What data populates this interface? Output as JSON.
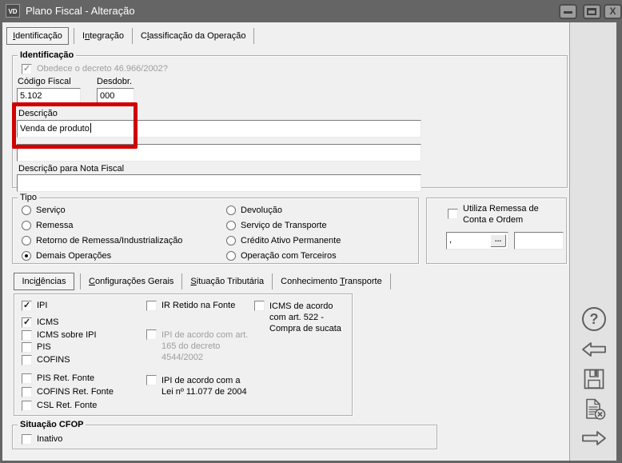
{
  "colors": {
    "titlebar": "#656565",
    "client_bg": "#f0f0f0",
    "side_panel_bg": "#e2e2e2",
    "annotation": "#d10000"
  },
  "window": {
    "title": "Plano Fiscal - Alteração",
    "icon_text": "VD",
    "close_glyph": "X"
  },
  "main_tabs": [
    {
      "label": "Identificação",
      "label_html": "<u>I</u>dentificação",
      "active": true
    },
    {
      "label": "Integração",
      "label_html": "I<u>n</u>tegração",
      "active": false
    },
    {
      "label": "Classificação da Operação",
      "label_html": "C<u>l</u>assificação da Operação",
      "active": false
    }
  ],
  "identificacao": {
    "group_label": "Identificação",
    "obedece_checkbox": {
      "label": "Obedece o decreto 46.966/2002?",
      "checked": true,
      "disabled": true
    },
    "codigo_fiscal": {
      "label": "Código Fiscal",
      "value": "5.102"
    },
    "desdobr": {
      "label": "Desdobr.",
      "value": "000"
    },
    "descricao": {
      "label": "Descrição",
      "value": "Venda de produto"
    },
    "descricao2": {
      "value": ""
    },
    "descricao_nf": {
      "label": "Descrição para Nota Fiscal",
      "value": ""
    }
  },
  "annotation": {
    "type": "highlight-box",
    "color": "#d10000",
    "around": "descricao-label-and-field"
  },
  "tipo": {
    "group_label": "Tipo",
    "options_left": [
      {
        "label": "Serviço",
        "selected": false
      },
      {
        "label": "Remessa",
        "selected": false
      },
      {
        "label": "Retorno de Remessa/Industrialização",
        "selected": false
      },
      {
        "label": "Demais Operações",
        "selected": true
      }
    ],
    "options_right": [
      {
        "label": "Devolução",
        "selected": false
      },
      {
        "label": "Serviço de Transporte",
        "selected": false
      },
      {
        "label": "Crédito Ativo Permanente",
        "selected": false
      },
      {
        "label": "Operação com Terceiros",
        "selected": false
      }
    ]
  },
  "remessa_conta_ordem": {
    "checkbox": {
      "label": "Utiliza Remessa de Conta e Ordem",
      "checked": false
    },
    "code_field": {
      "value": ",",
      "browse_button": "..."
    },
    "extra_field": {
      "value": ""
    }
  },
  "sub_tabs": [
    {
      "label": "Incidências",
      "label_html": "Inci<u>d</u>ências",
      "active": true
    },
    {
      "label": "Configurações Gerais",
      "label_html": "<u>C</u>onfigurações Gerais",
      "active": false
    },
    {
      "label": "Situação Tributária",
      "label_html": "<u>S</u>ituação Tributária",
      "active": false
    },
    {
      "label": "Conhecimento Transporte",
      "label_html": "Conhecimento <u>T</u>ransporte",
      "active": false
    }
  ],
  "incidencias": {
    "col1": [
      {
        "label": "IPI",
        "checked": true
      },
      {
        "label": "ICMS",
        "checked": true
      },
      {
        "label": "ICMS sobre IPI",
        "checked": false
      },
      {
        "label": "PIS",
        "checked": false
      },
      {
        "label": "COFINS",
        "checked": false
      },
      {
        "label": "PIS Ret. Fonte",
        "checked": false
      },
      {
        "label": "COFINS Ret. Fonte",
        "checked": false
      },
      {
        "label": "CSL Ret. Fonte",
        "checked": false
      }
    ],
    "col2": [
      {
        "label": "IR Retido na Fonte",
        "checked": false,
        "disabled": false
      },
      {
        "label": "IPI de acordo com art. 165 do decreto 4544/2002",
        "checked": false,
        "disabled": true
      },
      {
        "label": "IPI de acordo com a Lei nº 11.077 de 2004",
        "checked": false,
        "disabled": false
      }
    ],
    "col3": [
      {
        "label": "ICMS de acordo com art. 522  - Compra de sucata",
        "checked": false
      }
    ]
  },
  "situacao_cfop": {
    "group_label": "Situação CFOP",
    "inativo": {
      "label": "Inativo",
      "checked": false
    }
  },
  "side_toolbar": {
    "help_glyph": "?",
    "buttons": [
      "help",
      "back",
      "save",
      "delete-document",
      "forward"
    ]
  }
}
